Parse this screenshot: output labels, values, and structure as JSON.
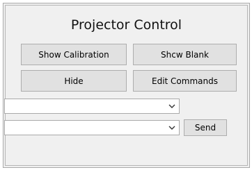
{
  "window": {
    "title": "Projector Control"
  },
  "buttons": {
    "show_calibration": "Show Calibration",
    "show_blank": "Shcw Blank",
    "hide": "Hide",
    "edit_commands": "Edit Commands",
    "send": "Send"
  },
  "combos": {
    "first": {
      "value": ""
    },
    "second": {
      "value": ""
    }
  },
  "icons": {
    "dropdown": "chevron-down-icon"
  }
}
